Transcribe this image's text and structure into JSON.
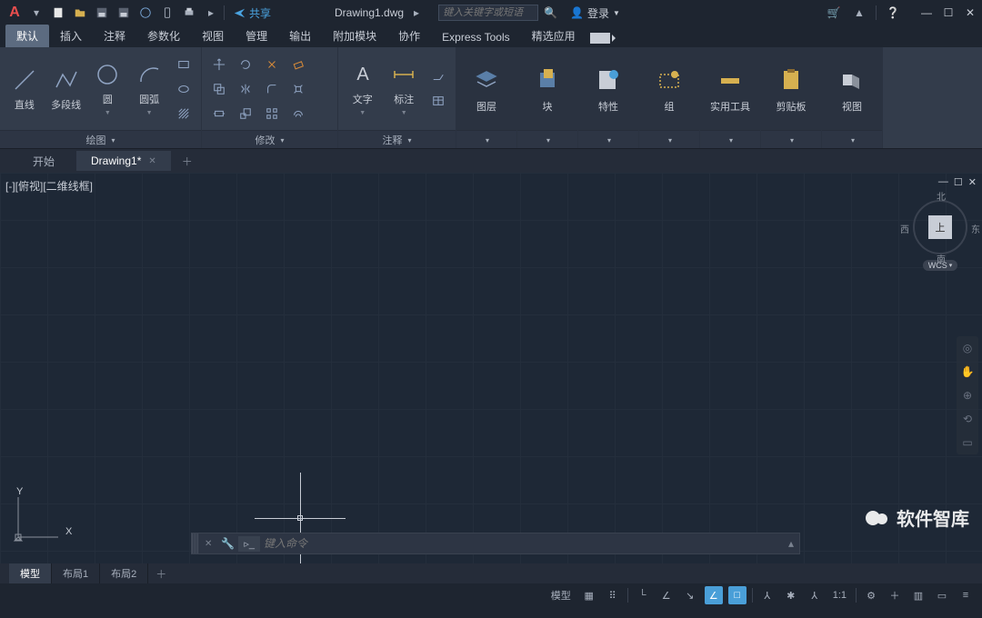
{
  "titlebar": {
    "share": "共享",
    "filename": "Drawing1.dwg",
    "search_placeholder": "键入关键字或短语",
    "login": "登录"
  },
  "ribbon_tabs": [
    "默认",
    "插入",
    "注释",
    "参数化",
    "视图",
    "管理",
    "输出",
    "附加模块",
    "协作",
    "Express Tools",
    "精选应用"
  ],
  "ribbon": {
    "draw": {
      "title": "绘图",
      "tools": [
        "直线",
        "多段线",
        "圆",
        "圆弧"
      ]
    },
    "modify": {
      "title": "修改"
    },
    "annotate": {
      "title": "注释",
      "tools": [
        "文字",
        "标注"
      ]
    },
    "layers": "图层",
    "blocks": "块",
    "properties": "特性",
    "groups": "组",
    "utils": "实用工具",
    "clipboard": "剪贴板",
    "view": "视图"
  },
  "file_tabs": {
    "start": "开始",
    "active": "Drawing1*"
  },
  "canvas": {
    "view_label": "[-][俯视][二维线框]",
    "ucs_x": "X",
    "ucs_y": "Y",
    "viewcube": {
      "n": "北",
      "s": "南",
      "e": "东",
      "w": "西",
      "top": "上",
      "wcs": "WCS"
    }
  },
  "cmdline": {
    "placeholder": "键入命令"
  },
  "layout_tabs": [
    "模型",
    "布局1",
    "布局2"
  ],
  "statusbar": {
    "model": "模型",
    "scale": "1:1"
  },
  "watermark": "软件智库"
}
